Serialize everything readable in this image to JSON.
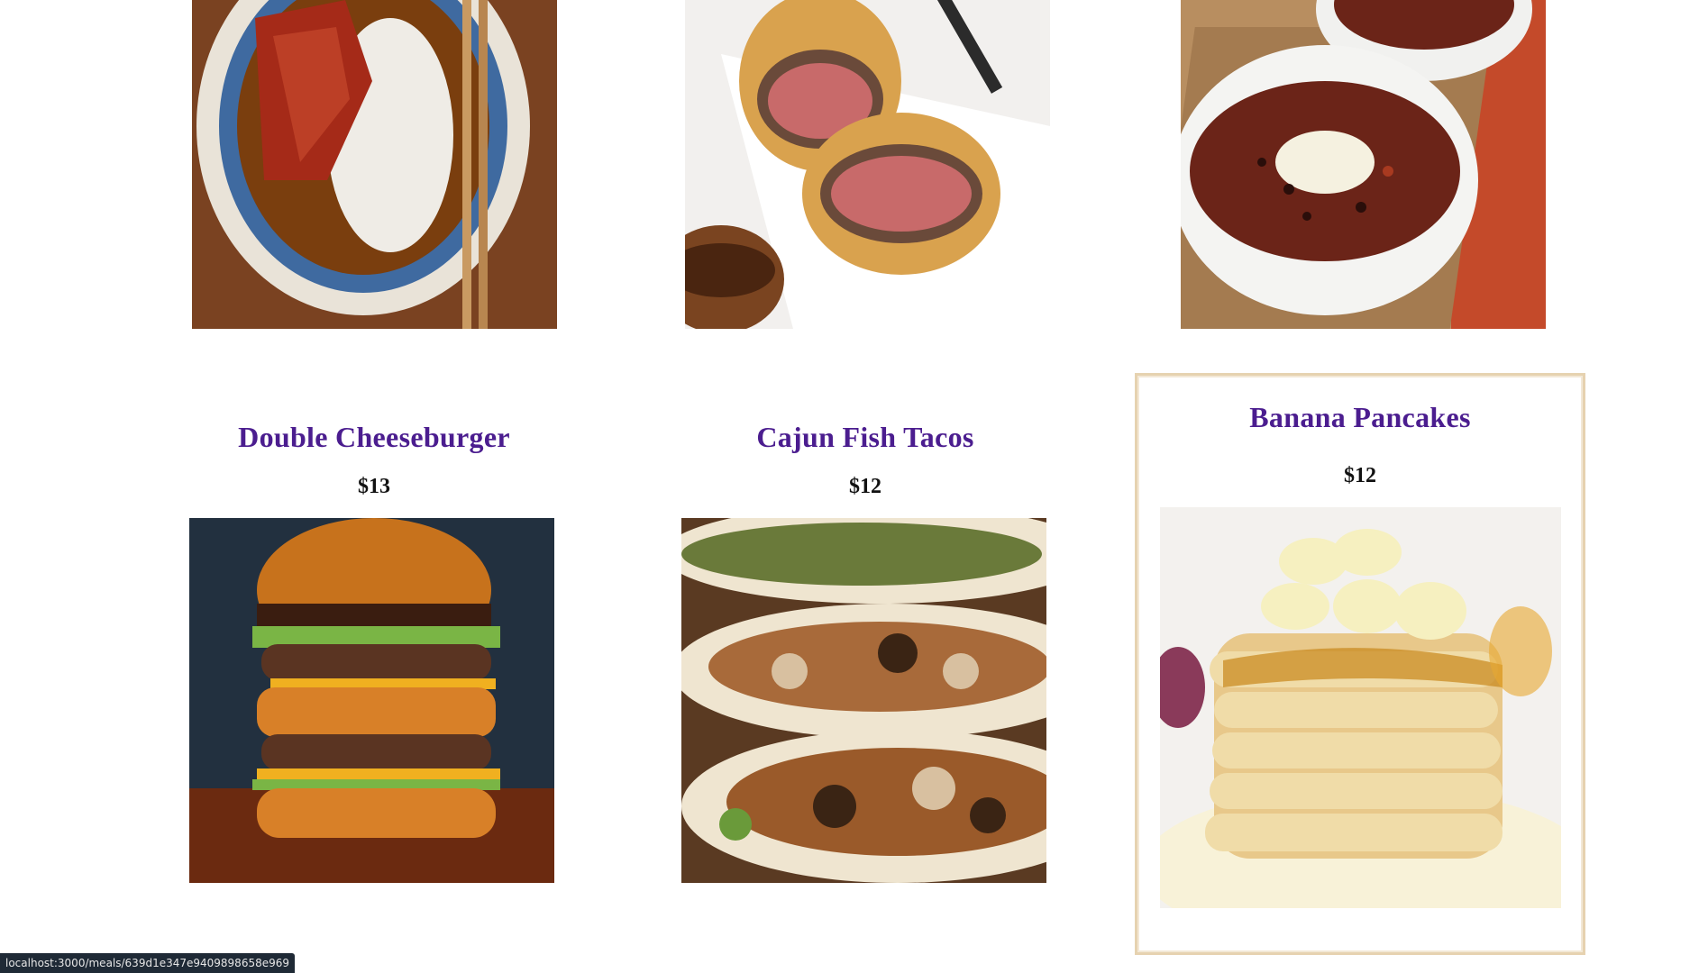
{
  "meals_top_row": [
    {
      "image_alt": "chicken katsu curry with rice"
    },
    {
      "image_alt": "beef wellington"
    },
    {
      "image_alt": "bean chili in white bowls"
    }
  ],
  "meals": [
    {
      "title": "Double Cheeseburger",
      "price": "$13",
      "image_alt": "double cheeseburger"
    },
    {
      "title": "Cajun Fish Tacos",
      "price": "$12",
      "image_alt": "cajun fish tacos"
    },
    {
      "title": "Banana Pancakes",
      "price": "$12",
      "image_alt": "banana pancakes with syrup"
    }
  ],
  "status_bar": {
    "url": "localhost:3000/meals/639d1e347e9409898658e969"
  },
  "colors": {
    "title": "#4b1d8f",
    "price": "#111111",
    "hover_border": "#e6d2b0"
  }
}
